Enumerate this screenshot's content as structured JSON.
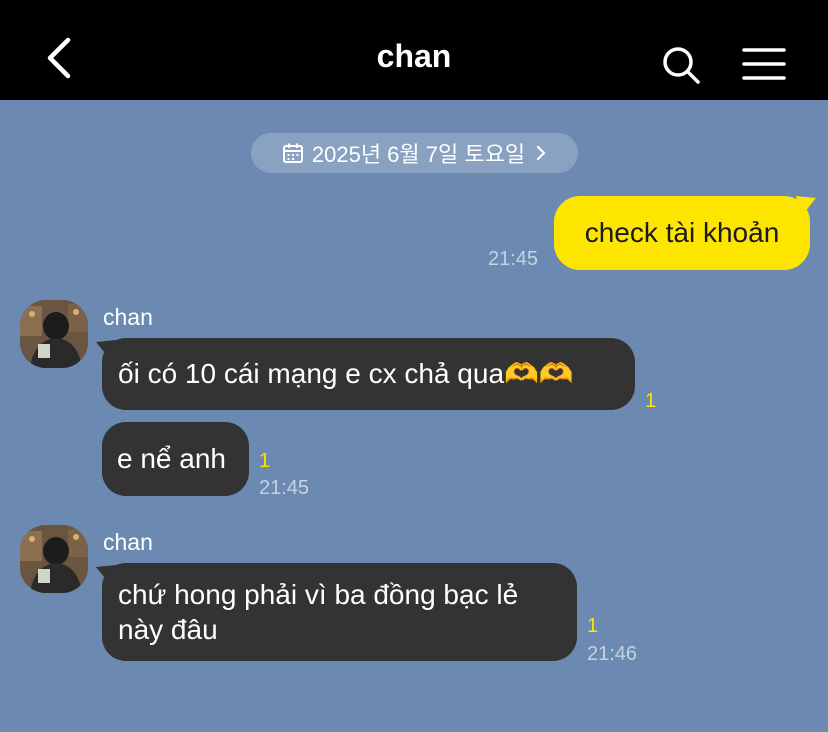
{
  "header": {
    "title": "chan",
    "back_icon": "chevron-left-icon",
    "search_icon": "search-icon",
    "menu_icon": "menu-icon"
  },
  "date_divider": {
    "text": "2025년 6월 7일 토요일",
    "icon": "calendar-icon",
    "chevron_icon": "chevron-right-icon"
  },
  "colors": {
    "chat_background": "#6b89b1",
    "my_bubble": "#fee500",
    "other_bubble": "#333333",
    "unread_count": "#fee500"
  },
  "messages": [
    {
      "sender": "me",
      "text": "check tài khoản",
      "time": "21:45"
    },
    {
      "sender": "chan",
      "text": "ối có 10 cái mạng e cx chả qua🫶🫶",
      "unread": "1"
    },
    {
      "sender": "chan",
      "text": "e nể anh",
      "unread": "1",
      "time": "21:45"
    },
    {
      "sender": "chan",
      "text": "chứ hong phải vì ba đồng bạc lẻ này đâu",
      "unread": "1",
      "time": "21:46"
    }
  ],
  "groups": [
    {
      "sender_name": "chan"
    },
    {
      "sender_name": "chan"
    }
  ]
}
